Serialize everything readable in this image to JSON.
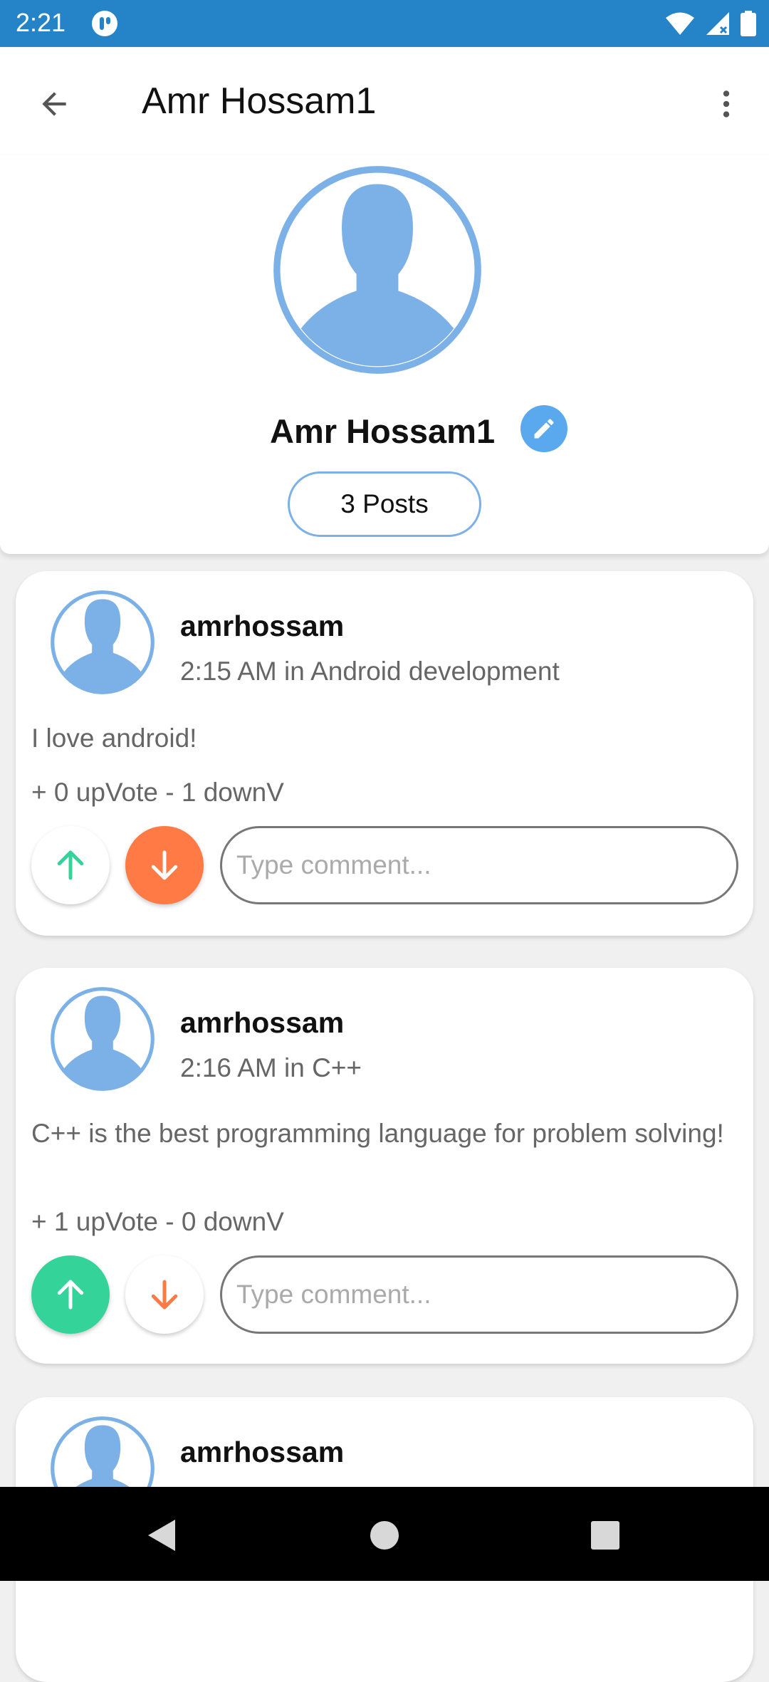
{
  "status_bar": {
    "time": "2:21"
  },
  "app_bar": {
    "title": "Amr Hossam1"
  },
  "profile": {
    "name": "Amr Hossam1",
    "posts_label": "3 Posts"
  },
  "posts": [
    {
      "user": "amrhossam",
      "meta": "2:15 AM in Android development",
      "body": "I love android!",
      "votes": "+ 0 upVote  - 1 downV",
      "comment_placeholder": "Type comment...",
      "upvoted": false,
      "downvoted": true
    },
    {
      "user": "amrhossam",
      "meta": "2:16 AM in C++",
      "body": "C++ is the best programming language for problem solving!",
      "votes": "+ 1 upVote  - 0 downV",
      "comment_placeholder": "Type comment...",
      "upvoted": true,
      "downvoted": false
    },
    {
      "user": "amrhossam"
    }
  ],
  "colors": {
    "status_bar": "#2584c8",
    "avatar_blue": "#7bb1e6",
    "edit_blue": "#5aa8ee",
    "upvote_green": "#34d399",
    "downvote_orange": "#ff7a45"
  },
  "icons": {
    "back": "arrow-back-icon",
    "more": "more-vert-icon",
    "edit": "pencil-icon",
    "upvote": "arrow-up-icon",
    "downvote": "arrow-down-icon"
  }
}
